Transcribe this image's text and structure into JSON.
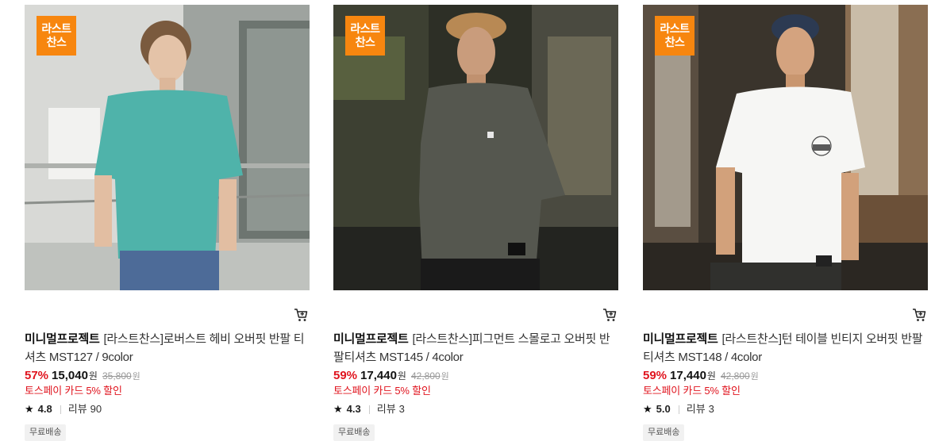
{
  "products": [
    {
      "badge": [
        "라스트",
        "찬스"
      ],
      "brand": "미니멀프로젝트",
      "name": "[라스트찬스]로버스트 헤비 오버핏 반팔 티셔츠 MST127 / 9color",
      "discount": "57%",
      "price": "15,040",
      "won": "원",
      "original_price": "35,800",
      "original_won": "원",
      "promo": "토스페이 카드 5% 할인",
      "star": "★",
      "rating": "4.8",
      "review_label": "리뷰",
      "review_count": "90",
      "tag": "무료배송",
      "shirt_color": "#4fb3aa"
    },
    {
      "badge": [
        "라스트",
        "찬스"
      ],
      "brand": "미니멀프로젝트",
      "name": "[라스트찬스]피그먼트 스몰로고 오버핏 반팔티셔츠 MST145 / 4color",
      "discount": "59%",
      "price": "17,440",
      "won": "원",
      "original_price": "42,800",
      "original_won": "원",
      "promo": "토스페이 카드 5% 할인",
      "star": "★",
      "rating": "4.3",
      "review_label": "리뷰",
      "review_count": "3",
      "tag": "무료배송",
      "shirt_color": "#55574f"
    },
    {
      "badge": [
        "라스트",
        "찬스"
      ],
      "brand": "미니멀프로젝트",
      "name": "[라스트찬스]턴 테이블 빈티지 오버핏 반팔티셔츠 MST148 / 4color",
      "discount": "59%",
      "price": "17,440",
      "won": "원",
      "original_price": "42,800",
      "original_won": "원",
      "promo": "토스페이 카드 5% 할인",
      "star": "★",
      "rating": "5.0",
      "review_label": "리뷰",
      "review_count": "3",
      "tag": "무료배송",
      "shirt_color": "#f6f6f4"
    }
  ],
  "colors": {
    "badge": "#f7860f",
    "discount": "#e0141e",
    "promo": "#e0141e"
  },
  "icons": {
    "cart": "cart-icon",
    "star": "star-icon"
  }
}
